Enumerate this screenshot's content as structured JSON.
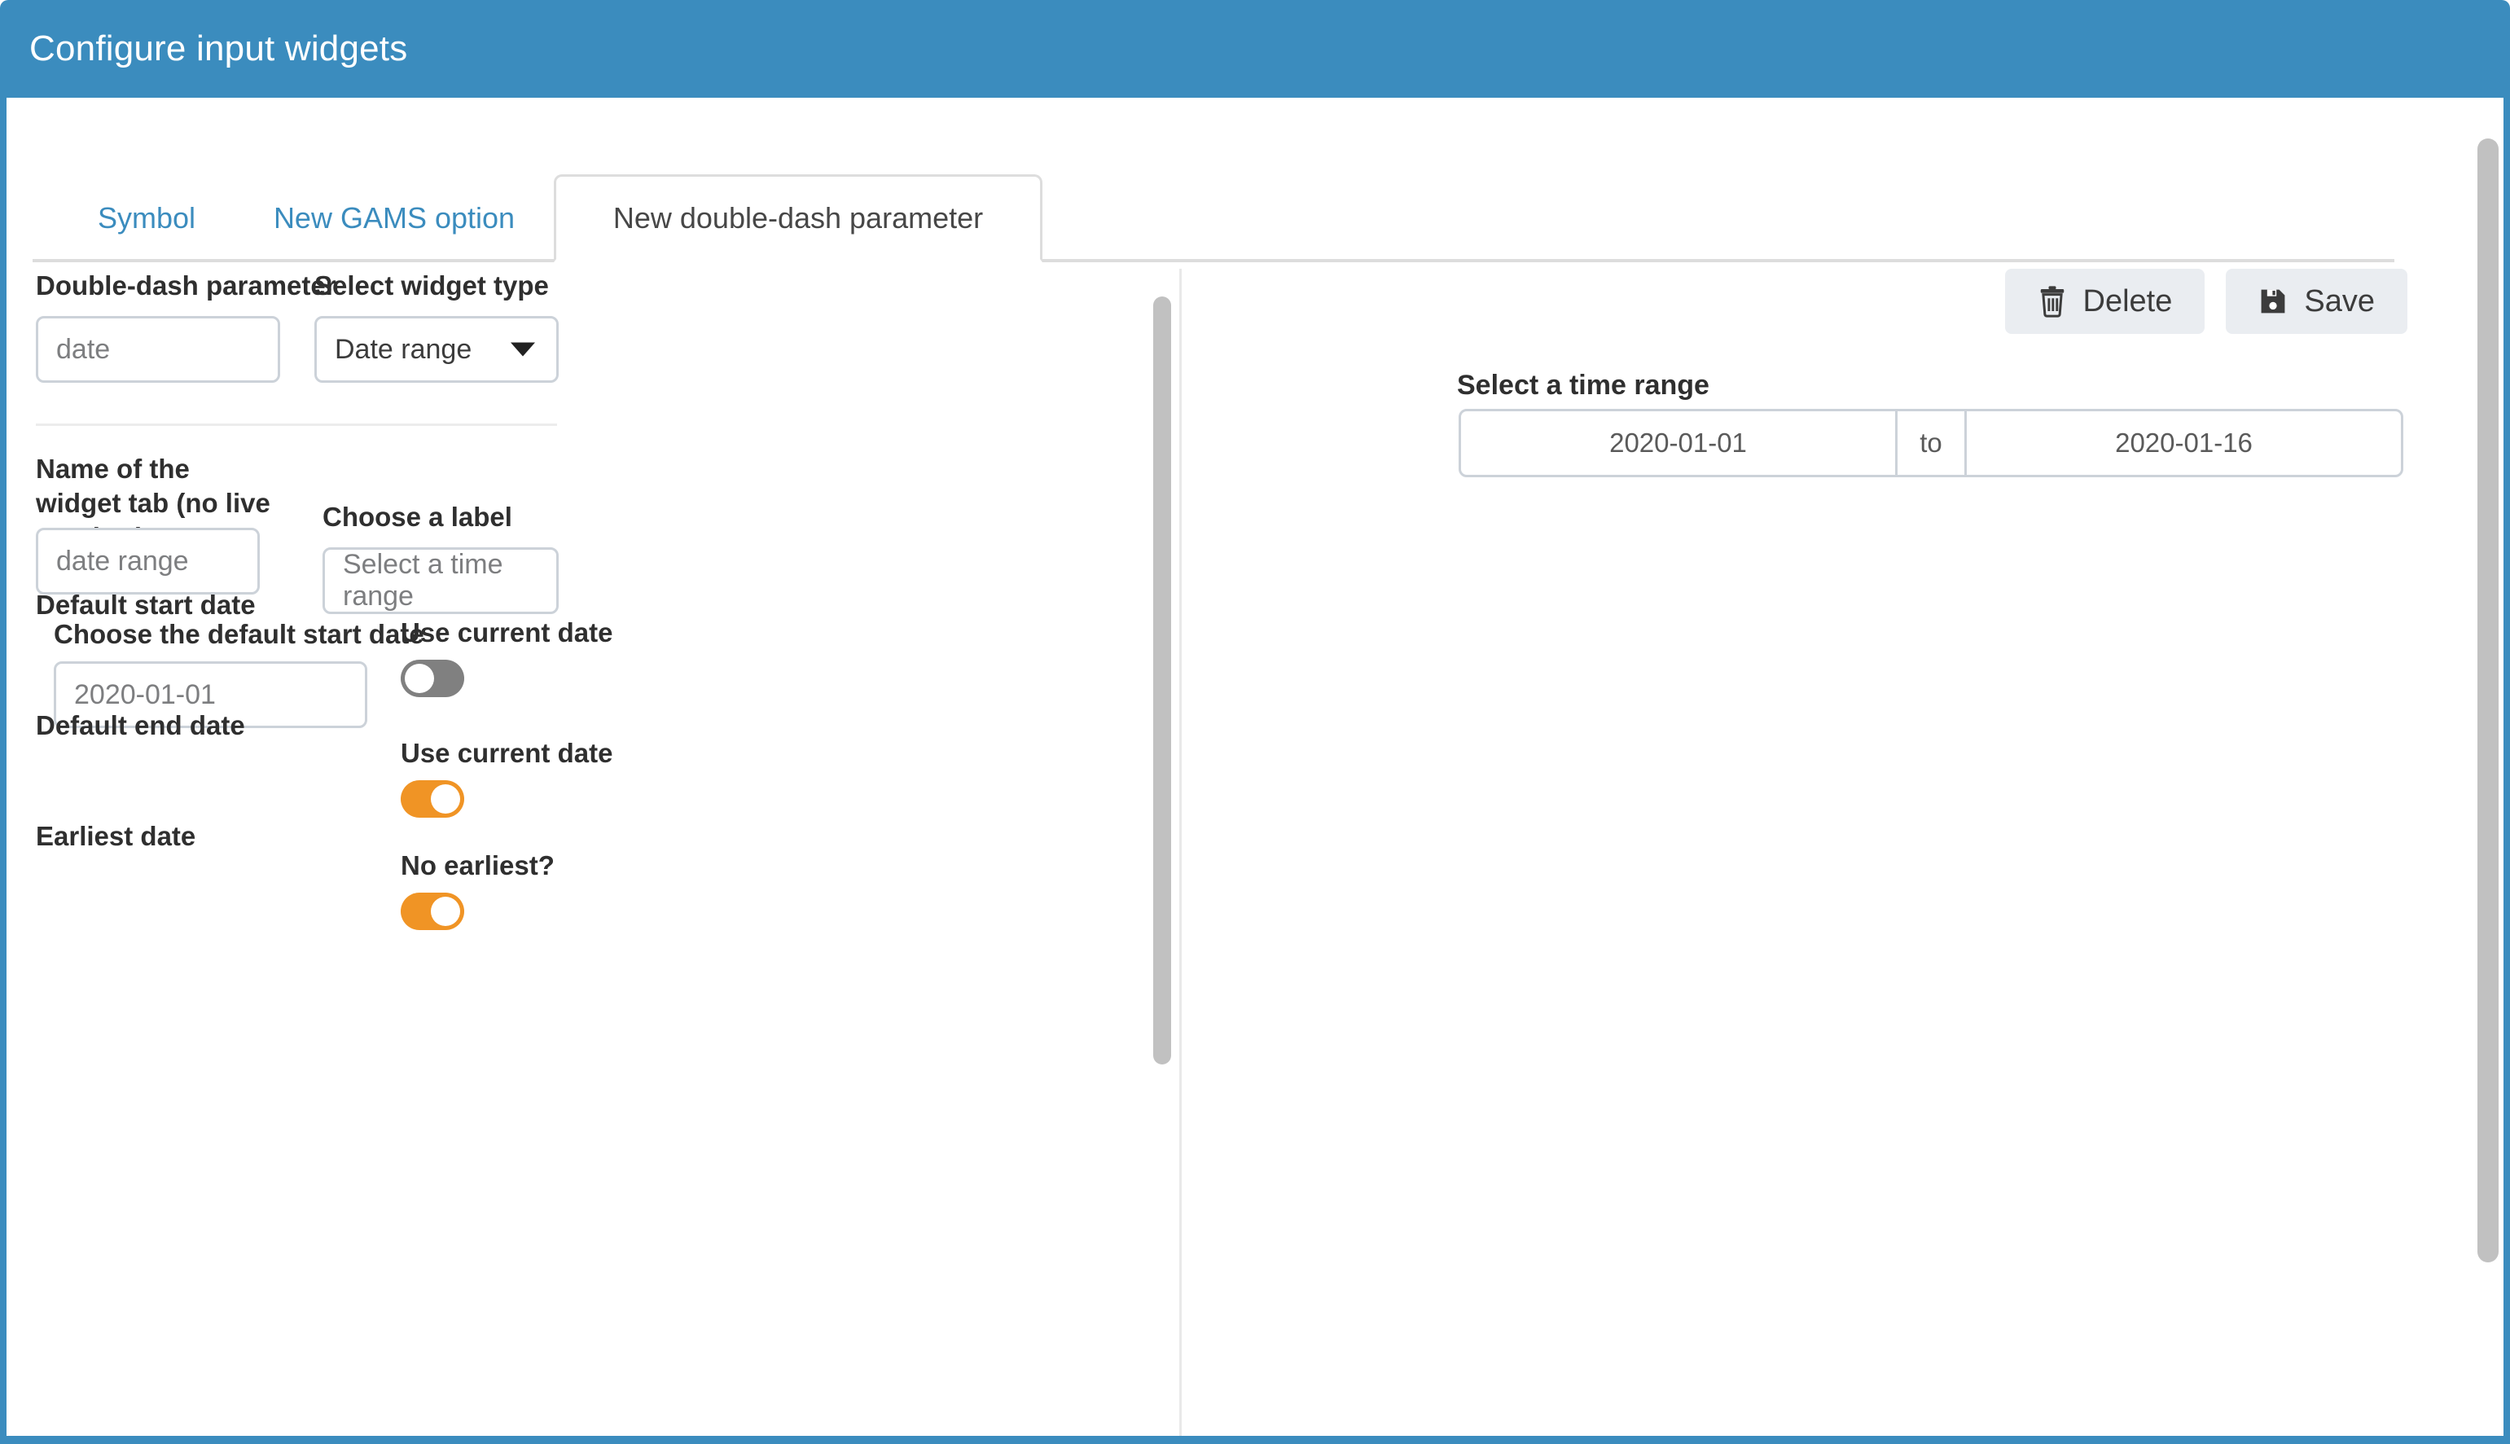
{
  "window": {
    "title": "Configure input widgets",
    "header_color": "#3b8cbe",
    "accent_color": "#f09425"
  },
  "tabs": [
    {
      "label": "Symbol",
      "active": false
    },
    {
      "label": "New GAMS option",
      "active": false
    },
    {
      "label": "New double-dash parameter",
      "active": true
    }
  ],
  "form": {
    "parameter": {
      "label": "Double-dash parameter",
      "value": "date",
      "placeholder": "date"
    },
    "widget_type": {
      "label": "Select widget type",
      "value": "Date range",
      "caret_icon": "chevron-down-icon"
    },
    "tab_name": {
      "label": "Name of the widget tab (no live preview)",
      "value": "date range",
      "placeholder": "date range"
    },
    "choose_label": {
      "label": "Choose a label",
      "value": "Select a time range",
      "placeholder": "Select a time range"
    },
    "default_start_date": {
      "section_label": "Default start date",
      "field_label": "Choose the default start date",
      "value": "2020-01-01",
      "toggle_label": "Use current date",
      "toggle_on": false
    },
    "default_end_date": {
      "section_label": "Default end date",
      "toggle_label": "Use current date",
      "toggle_on": true
    },
    "earliest_date": {
      "section_label": "Earliest date",
      "toggle_label": "No earliest?",
      "toggle_on": true
    }
  },
  "actions": {
    "delete_label": "Delete",
    "delete_icon": "trash-icon",
    "save_label": "Save",
    "save_icon": "floppy-disk-icon"
  },
  "preview": {
    "label": "Select a time range",
    "start_value": "2020-01-01",
    "separator": "to",
    "end_value": "2020-01-16"
  }
}
